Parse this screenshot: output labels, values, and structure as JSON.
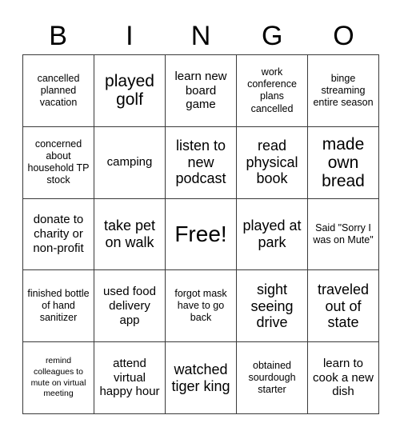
{
  "header": {
    "letters": [
      "B",
      "I",
      "N",
      "G",
      "O"
    ]
  },
  "grid": {
    "rows": [
      [
        {
          "text": "cancelled planned vacation",
          "size": "t-sm"
        },
        {
          "text": "played golf",
          "size": "t-xl"
        },
        {
          "text": "learn new board game",
          "size": "t-md"
        },
        {
          "text": "work conference plans cancelled",
          "size": "t-sm"
        },
        {
          "text": "binge streaming entire season",
          "size": "t-sm"
        }
      ],
      [
        {
          "text": "concerned about household TP stock",
          "size": "t-sm"
        },
        {
          "text": "camping",
          "size": "t-md"
        },
        {
          "text": "listen to new podcast",
          "size": "t-lg"
        },
        {
          "text": "read physical book",
          "size": "t-lg"
        },
        {
          "text": "made own bread",
          "size": "t-xl"
        }
      ],
      [
        {
          "text": "donate to charity or non-profit",
          "size": "t-md"
        },
        {
          "text": "take pet on walk",
          "size": "t-lg"
        },
        {
          "text": "Free!",
          "size": "t-free"
        },
        {
          "text": "played at park",
          "size": "t-lg"
        },
        {
          "text": "Said \"Sorry I was on Mute\"",
          "size": "t-sm"
        }
      ],
      [
        {
          "text": "finished bottle of hand sanitizer",
          "size": "t-sm"
        },
        {
          "text": "used food delivery app",
          "size": "t-md"
        },
        {
          "text": "forgot mask have to go back",
          "size": "t-sm"
        },
        {
          "text": "sight seeing drive",
          "size": "t-lg"
        },
        {
          "text": "traveled out of state",
          "size": "t-lg"
        }
      ],
      [
        {
          "text": "remind colleagues to mute on virtual meeting",
          "size": "t-xs"
        },
        {
          "text": "attend virtual happy hour",
          "size": "t-md"
        },
        {
          "text": "watched tiger king",
          "size": "t-lg"
        },
        {
          "text": "obtained sourdough starter",
          "size": "t-sm"
        },
        {
          "text": "learn to cook a new dish",
          "size": "t-md"
        }
      ]
    ]
  }
}
